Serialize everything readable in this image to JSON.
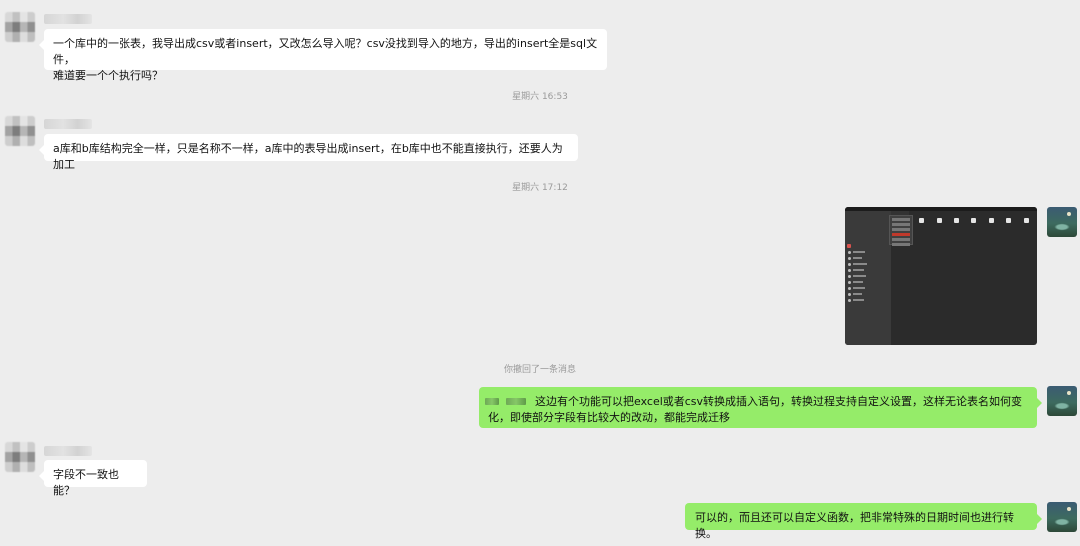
{
  "messages": [
    {
      "side": "in",
      "text": "一个库中的一张表，我导出成csv或者insert，又改怎么导入呢？csv没找到导入的地方，导出的insert全是sql文件，难道要一个个执行吗？"
    },
    {
      "timestamp": "星期六 16:53"
    },
    {
      "side": "in",
      "text": "a库和b库结构完全一样，只是名称不一样，a库中的表导出成insert，在b库中也不能直接执行，还要人为加工"
    },
    {
      "timestamp": "星期六 17:12"
    },
    {
      "side": "out",
      "image": "database-client-screenshot"
    },
    {
      "notice": "你撤回了一条消息"
    },
    {
      "side": "out",
      "text": "这边有个功能可以把excel或者csv转换成插入语句，转换过程支持自定义设置，这样无论表名如何变化，即使部分字段有比较大的改动，都能完成迁移"
    },
    {
      "side": "in",
      "text": "字段不一致也能？"
    },
    {
      "side": "out",
      "text": "可以的，而且还可以自定义函数，把非常特殊的日期时间也进行转换。"
    }
  ],
  "chat": {
    "msg1": "一个库中的一张表，我导出成csv或者insert，又改怎么导入呢？csv没找到导入的地方，导出的insert全是sql文件，",
    "msg1_line2": "难道要一个个执行吗？",
    "ts1": "星期六 16:53",
    "msg2": "a库和b库结构完全一样，只是名称不一样，a库中的表导出成insert，在b库中也不能直接执行，还要人为加工",
    "ts2": "星期六 17:12",
    "notice": "你撤回了一条消息",
    "msg3_line1": "这边有个功能可以把excel或者csv转换成插入语句，转换过程支持自定义设置，这样无论表名如何变",
    "msg3_line2": "化，即使部分字段有比较大的改动，都能完成迁移",
    "msg4": "字段不一致也能？",
    "msg5": "可以的，而且还可以自定义函数，把非常特殊的日期时间也进行转换。"
  },
  "colors": {
    "background": "#ededed",
    "incoming_bubble": "#ffffff",
    "outgoing_bubble": "#95ec69",
    "meta_text": "#9a9a9a"
  }
}
